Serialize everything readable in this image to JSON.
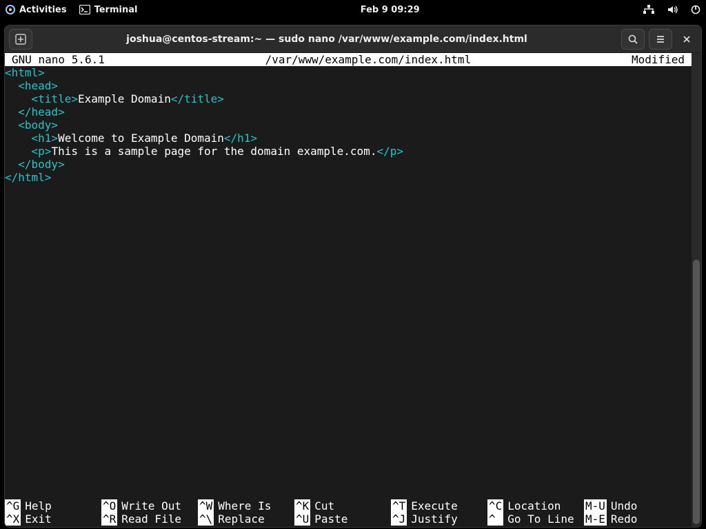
{
  "topbar": {
    "activities": "Activities",
    "app": "Terminal",
    "clock": "Feb 9  09:29"
  },
  "window": {
    "title": "joshua@centos-stream:~ — sudo nano /var/www/example.com/index.html"
  },
  "nano": {
    "version": "GNU nano 5.6.1",
    "filepath": "/var/www/example.com/index.html",
    "status": "Modified",
    "lines": [
      {
        "indent": "",
        "open": "<html>",
        "text": "",
        "close": ""
      },
      {
        "indent": "  ",
        "open": "<head>",
        "text": "",
        "close": ""
      },
      {
        "indent": "    ",
        "open": "<title>",
        "text": "Example Domain",
        "close": "</title>"
      },
      {
        "indent": "  ",
        "open": "</head>",
        "text": "",
        "close": ""
      },
      {
        "indent": "  ",
        "open": "<body>",
        "text": "",
        "close": ""
      },
      {
        "indent": "    ",
        "open": "<h1>",
        "text": "Welcome to Example Domain",
        "close": "</h1>"
      },
      {
        "indent": "    ",
        "open": "<p>",
        "text": "This is a sample page for the domain example.com.",
        "close": "</p>"
      },
      {
        "indent": "  ",
        "open": "</body>",
        "text": "",
        "close": ""
      },
      {
        "indent": "",
        "open": "</html>",
        "text": "",
        "close": ""
      }
    ],
    "shortcuts_row1": [
      {
        "key": "^G",
        "label": "Help"
      },
      {
        "key": "^O",
        "label": "Write Out"
      },
      {
        "key": "^W",
        "label": "Where Is"
      },
      {
        "key": "^K",
        "label": "Cut"
      },
      {
        "key": "^T",
        "label": "Execute"
      },
      {
        "key": "^C",
        "label": "Location"
      },
      {
        "key": "M-U",
        "label": "Undo"
      }
    ],
    "shortcuts_row2": [
      {
        "key": "^X",
        "label": "Exit"
      },
      {
        "key": "^R",
        "label": "Read File"
      },
      {
        "key": "^\\",
        "label": "Replace"
      },
      {
        "key": "^U",
        "label": "Paste"
      },
      {
        "key": "^J",
        "label": "Justify"
      },
      {
        "key": "^ ",
        "label": "Go To Line"
      },
      {
        "key": "M-E",
        "label": "Redo"
      }
    ]
  }
}
